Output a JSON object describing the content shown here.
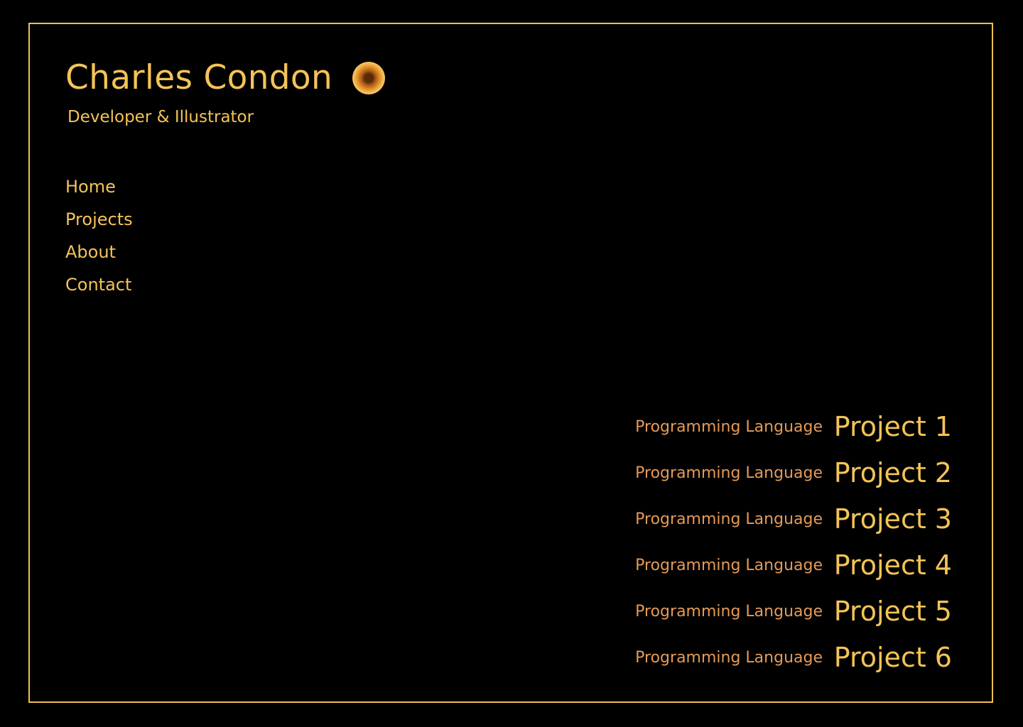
{
  "header": {
    "name": "Charles Condon",
    "tagline": "Developer & Illustrator",
    "logo_icon": "sun-orb-icon"
  },
  "nav": {
    "items": [
      {
        "label": "Home"
      },
      {
        "label": "Projects"
      },
      {
        "label": "About"
      },
      {
        "label": "Contact"
      }
    ]
  },
  "projects": [
    {
      "language": "Programming Language",
      "title": "Project 1"
    },
    {
      "language": "Programming Language",
      "title": "Project 2"
    },
    {
      "language": "Programming Language",
      "title": "Project 3"
    },
    {
      "language": "Programming Language",
      "title": "Project 4"
    },
    {
      "language": "Programming Language",
      "title": "Project 5"
    },
    {
      "language": "Programming Language",
      "title": "Project 6"
    }
  ],
  "colors": {
    "background": "#000000",
    "accent": "#f3c457",
    "secondary": "#e49a57",
    "frame": "#f0c050"
  }
}
